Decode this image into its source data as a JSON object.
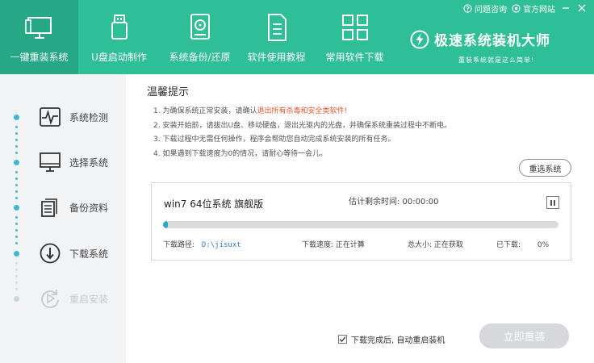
{
  "header": {
    "nav": [
      {
        "label": "一键重装系统",
        "icon": "monitor-icon",
        "active": true
      },
      {
        "label": "U盘启动制作",
        "icon": "usb-icon",
        "active": false
      },
      {
        "label": "系统备份/还原",
        "icon": "disk-icon",
        "active": false
      },
      {
        "label": "软件使用教程",
        "icon": "document-icon",
        "active": false
      },
      {
        "label": "常用软件下载",
        "icon": "apps-grid-icon",
        "active": false
      }
    ],
    "links": {
      "help": "问题咨询",
      "website": "官方网站"
    },
    "brand": {
      "title": "极速系统装机大师",
      "subtitle": "重装系统就是这么简单!"
    }
  },
  "sidebar": {
    "steps": [
      {
        "label": "系统检测",
        "icon": "pulse-icon",
        "state": "done"
      },
      {
        "label": "选择系统",
        "icon": "desktop-icon",
        "state": "done"
      },
      {
        "label": "备份资料",
        "icon": "copy-icon",
        "state": "done"
      },
      {
        "label": "下载系统",
        "icon": "download-icon",
        "state": "current"
      },
      {
        "label": "重启安装",
        "icon": "restart-icon",
        "state": "pending"
      }
    ]
  },
  "main": {
    "title": "温馨提示",
    "tips": {
      "t1_pre": "1. 为确保系统正常安装，请确认",
      "t1_warn": "退出所有杀毒和安全类软件!",
      "t2": "2. 安装开始前，请拔出U盘、移动硬盘，退出光驱内的光盘，并确保系统重装过程中不断电。",
      "t3": "3. 下载过程中无需任何操作，程序会帮助您自动完成系统安装的所有任务。",
      "t4": "4. 如果遇到下载速度为0的情况，请耐心等待一会儿。"
    },
    "reselect_label": "重选系统",
    "download": {
      "name": "win7 64位系统 旗舰版",
      "remaining": "估计剩余时间: 00:00:00",
      "progress": 0.01,
      "path_label": "下载路径:",
      "path_value": "D:\\jisuxt",
      "speed": "下载速度: 正在计算",
      "total": "总大小: 正在获取",
      "downloaded": "已下载:",
      "downloaded_value": "0%"
    },
    "auto_restart_label": "下载完成后, 自动重启装机",
    "auto_restart_checked": true,
    "install_label": "立即重装"
  },
  "colors": {
    "accent": "#2fbf96",
    "progress": "#2aa6c9",
    "warn": "#e8542c"
  }
}
